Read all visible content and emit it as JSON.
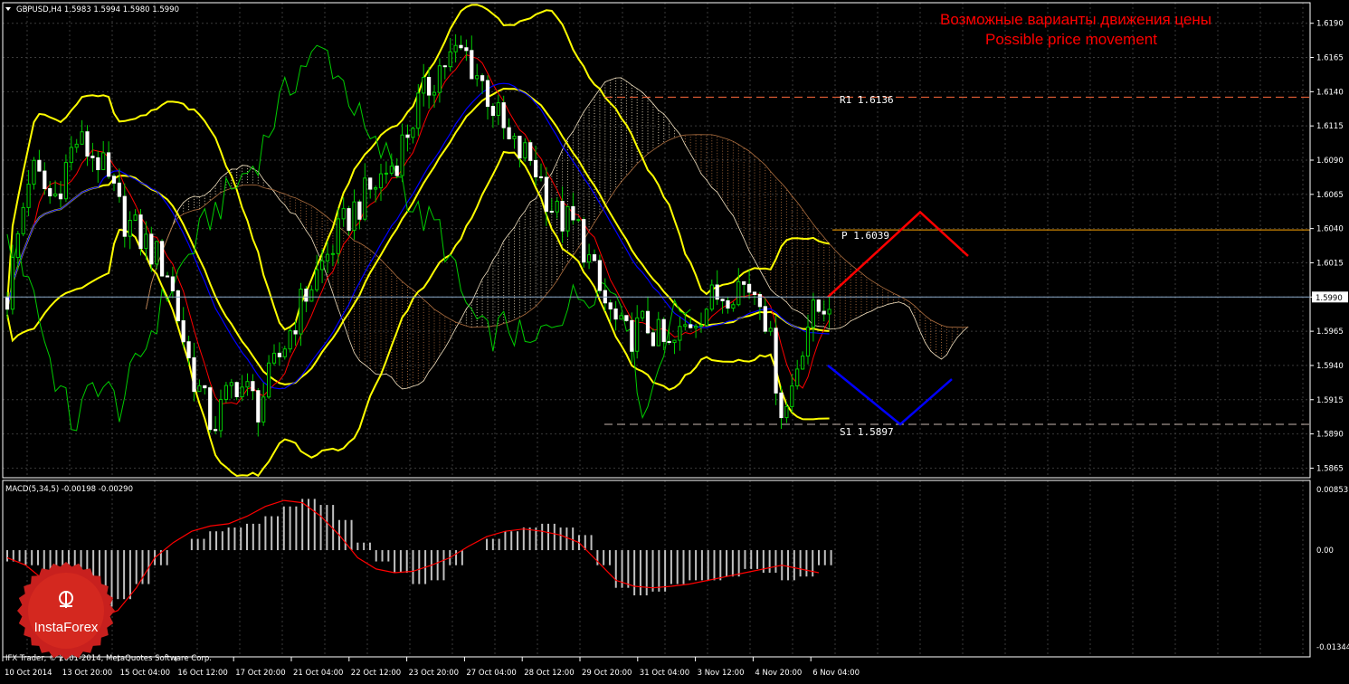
{
  "header": {
    "symbol_line": "GBPUSD,H4  1.5983 1.5994 1.5980 1.5990"
  },
  "annotation": {
    "ru": "Возможные варианты движения цены",
    "en": "Possible price movement"
  },
  "levels": {
    "r1": {
      "label": "R1  1.6136",
      "price": 1.6136
    },
    "p": {
      "label": "P  1.6039",
      "price": 1.6039
    },
    "s1": {
      "label": "S1  1.5897",
      "price": 1.5897
    },
    "current": {
      "label": "1.5990",
      "price": 1.599
    }
  },
  "macd": {
    "label": "MACD(5,34,5) -0.00198 -0.00290",
    "ticks": [
      "0.00853",
      "0.00",
      "-0.01344"
    ]
  },
  "footer": {
    "copyright": "IFX Trader, © 2001-2014, MetaQuotes Software Corp."
  },
  "logo": {
    "text": "InstaForex"
  },
  "colors": {
    "background": "#000000",
    "grid": "#3a3a3a",
    "candle": "#00cc00",
    "bollinger": "#ffff00",
    "tenkan": "#ff0000",
    "kijun": "#0000ff",
    "chikou": "#00cc00",
    "cloud_up": "#f0e0c0",
    "cloud_down": "#b07040",
    "pivot": "#ffa500",
    "scenario_up": "#ff0000",
    "scenario_down": "#0000ff",
    "macd_hist": "#c0c0c0",
    "macd_signal": "#ff0000"
  },
  "chart_data": {
    "type": "candlestick",
    "symbol": "GBPUSD",
    "timeframe": "H4",
    "ylim": [
      1.5858,
      1.6205
    ],
    "y_ticks": [
      1.619,
      1.6165,
      1.614,
      1.6115,
      1.609,
      1.6065,
      1.604,
      1.6015,
      1.599,
      1.5965,
      1.594,
      1.5915,
      1.589,
      1.5865
    ],
    "x_ticks": [
      "10 Oct 2014",
      "13 Oct 20:00",
      "15 Oct 04:00",
      "16 Oct 12:00",
      "17 Oct 20:00",
      "21 Oct 04:00",
      "22 Oct 12:00",
      "23 Oct 20:00",
      "27 Oct 04:00",
      "28 Oct 12:00",
      "29 Oct 20:00",
      "31 Oct 04:00",
      "3 Nov 12:00",
      "4 Nov 20:00",
      "6 Nov 04:00"
    ],
    "last_price": 1.599,
    "price_path": [
      1.599,
      1.6085,
      1.606,
      1.6105,
      1.609,
      1.605,
      1.603,
      1.601,
      1.594,
      1.5895,
      1.593,
      1.591,
      1.595,
      1.599,
      1.602,
      1.605,
      1.607,
      1.609,
      1.613,
      1.616,
      1.617,
      1.614,
      1.61,
      1.609,
      1.605,
      1.604,
      1.599,
      1.596,
      1.597,
      1.595,
      1.5975,
      1.599,
      1.6,
      1.5995,
      1.59,
      1.597,
      1.599
    ],
    "scenario_up": [
      1.599,
      1.6052,
      1.602
    ],
    "scenario_down": [
      1.594,
      1.5897,
      1.593
    ],
    "macd": {
      "ylim": [
        -0.01344,
        0.00853
      ],
      "histogram": [
        -0.0015,
        -0.002,
        -0.003,
        -0.005,
        -0.0068,
        -0.0075,
        -0.0065,
        -0.0045,
        -0.002,
        0.0,
        0.0015,
        0.0025,
        0.003,
        0.0035,
        0.0045,
        0.0058,
        0.0068,
        0.006,
        0.004,
        0.001,
        -0.0015,
        -0.003,
        -0.0045,
        -0.004,
        -0.002,
        0.0,
        0.0015,
        0.0025,
        0.003,
        0.0035,
        0.003,
        0.002,
        -0.002,
        -0.005,
        -0.006,
        -0.0055,
        -0.0045,
        -0.004,
        -0.004,
        -0.0035,
        -0.0025,
        -0.003,
        -0.004,
        -0.0035,
        -0.002
      ],
      "signal": [
        -0.001,
        -0.002,
        -0.004,
        -0.006,
        -0.008,
        -0.009,
        -0.008,
        -0.005,
        -0.001,
        0.001,
        0.0025,
        0.0032,
        0.0035,
        0.0045,
        0.0058,
        0.0066,
        0.0063,
        0.0045,
        0.002,
        -0.001,
        -0.0025,
        -0.003,
        -0.0028,
        -0.002,
        -0.001,
        0.0005,
        0.0018,
        0.0025,
        0.0028,
        0.0025,
        0.002,
        0.001,
        -0.0015,
        -0.004,
        -0.0048,
        -0.005,
        -0.0048,
        -0.0045,
        -0.004,
        -0.0035,
        -0.003,
        -0.0025,
        -0.002,
        -0.0025,
        -0.003
      ]
    }
  }
}
